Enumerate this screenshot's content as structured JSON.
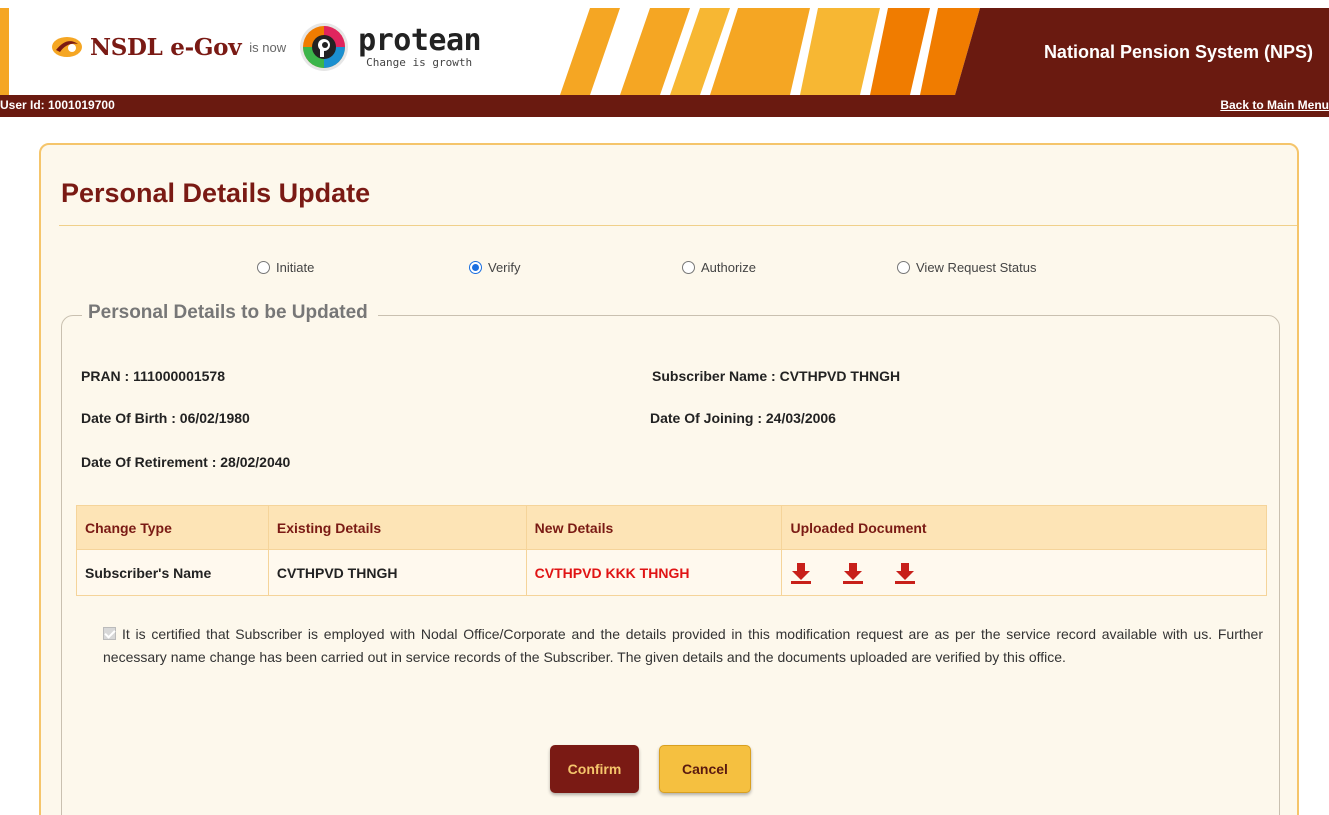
{
  "header": {
    "brand_primary": "NSDL e-Gov",
    "brand_is_now": "is now",
    "brand_secondary": "protean",
    "brand_tagline": "Change is growth",
    "system_title": "National Pension System (NPS)",
    "colors": {
      "maroon": "#6a1a10",
      "gold": "#f5a623",
      "orange": "#f07c00"
    }
  },
  "userbar": {
    "user_id": "User Id: 1001019700",
    "back_link": "Back to Main Menu"
  },
  "page": {
    "title": "Personal Details Update"
  },
  "steps": [
    {
      "label": "Initiate",
      "checked": false
    },
    {
      "label": "Verify",
      "checked": true
    },
    {
      "label": "Authorize",
      "checked": false
    },
    {
      "label": "View Request Status",
      "checked": false
    }
  ],
  "section": {
    "legend": "Personal Details to be Updated",
    "pran": "PRAN : 111000001578",
    "subscriber_name": "Subscriber Name : CVTHPVD THNGH",
    "dob": "Date Of Birth : 06/02/1980",
    "doj": "Date Of Joining : 24/03/2006",
    "dor": "Date Of Retirement : 28/02/2040"
  },
  "table": {
    "headers": [
      "Change Type",
      "Existing Details",
      "New Details",
      "Uploaded Document"
    ],
    "rows": [
      {
        "change_type": "Subscriber's Name",
        "existing": "CVTHPVD THNGH",
        "new": "CVTHPVD KKK THNGH",
        "documents": [
          "download-icon",
          "download-icon",
          "download-icon"
        ]
      }
    ]
  },
  "certification": {
    "checked": true,
    "text": "It is certified that Subscriber is employed with Nodal Office/Corporate and the details provided in this modification request are as per the service record available with us. Further necessary name change has been carried out in service records of the Subscriber. The given details and the documents uploaded are verified by this office."
  },
  "buttons": {
    "confirm": "Confirm",
    "cancel": "Cancel"
  }
}
